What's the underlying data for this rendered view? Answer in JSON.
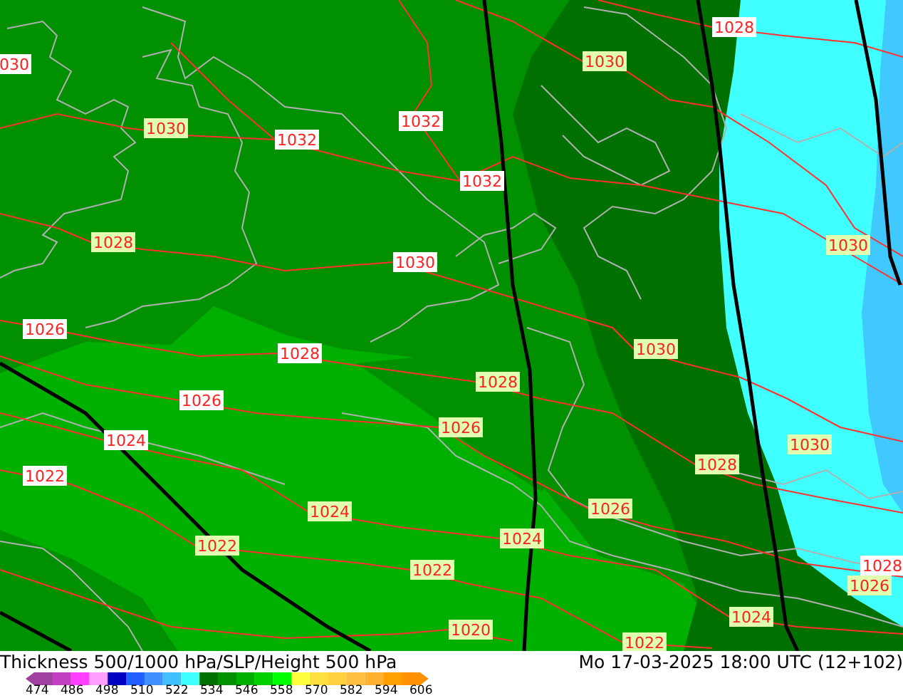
{
  "map": {
    "isobar_labels": [
      {
        "text": "030",
        "color": "#ffffff"
      },
      {
        "text": "1030",
        "color": "#e0ffb0"
      },
      {
        "text": "1032",
        "color": "#ffffff"
      },
      {
        "text": "1032",
        "color": "#ffffff"
      },
      {
        "text": "1028",
        "color": "#ffffff"
      },
      {
        "text": "1030",
        "color": "#e0ffb0"
      },
      {
        "text": "1032",
        "color": "#ffffff"
      },
      {
        "text": "1028",
        "color": "#e0ffb0"
      },
      {
        "text": "1030",
        "color": "#ffffff"
      },
      {
        "text": "1030",
        "color": "#e0ffb0"
      },
      {
        "text": "1026",
        "color": "#ffffff"
      },
      {
        "text": "1028",
        "color": "#ffffff"
      },
      {
        "text": "1030",
        "color": "#e0ffb0"
      },
      {
        "text": "1028",
        "color": "#e0ffb0"
      },
      {
        "text": "1026",
        "color": "#ffffff"
      },
      {
        "text": "1026",
        "color": "#e0ffb0"
      },
      {
        "text": "1024",
        "color": "#ffffff"
      },
      {
        "text": "1030",
        "color": "#e0ffb0"
      },
      {
        "text": "1028",
        "color": "#e0ffb0"
      },
      {
        "text": "1022",
        "color": "#ffffff"
      },
      {
        "text": "1026",
        "color": "#e0ffb0"
      },
      {
        "text": "1024",
        "color": "#e0ffb0"
      },
      {
        "text": "1024",
        "color": "#e0ffb0"
      },
      {
        "text": "1022",
        "color": "#e0ffb0"
      },
      {
        "text": "1028",
        "color": "#ffffff"
      },
      {
        "text": "1022",
        "color": "#e0ffb0"
      },
      {
        "text": "1026",
        "color": "#e0ffb0"
      },
      {
        "text": "1024",
        "color": "#e0ffb0"
      },
      {
        "text": "1020",
        "color": "#e0ffb0"
      },
      {
        "text": "1022",
        "color": "#e0ffb0"
      }
    ]
  },
  "footer": {
    "title": "Thickness 500/1000 hPa/SLP/Height 500 hPa",
    "datetime": "Mo 17-03-2025 18:00 UTC (12+102)",
    "legend": {
      "swatches": [
        {
          "color": "#a040a0"
        },
        {
          "color": "#c040c0"
        },
        {
          "color": "#ff40ff"
        },
        {
          "color": "#ffa0ff"
        },
        {
          "color": "#0000c0"
        },
        {
          "color": "#2060ff"
        },
        {
          "color": "#4090ff"
        },
        {
          "color": "#40c0ff"
        },
        {
          "color": "#40ffff"
        },
        {
          "color": "#007000"
        },
        {
          "color": "#009000"
        },
        {
          "color": "#00b000"
        },
        {
          "color": "#00d000"
        },
        {
          "color": "#00ff00"
        },
        {
          "color": "#ffff40"
        },
        {
          "color": "#ffe040"
        },
        {
          "color": "#ffd040"
        },
        {
          "color": "#ffc040"
        },
        {
          "color": "#ffb030"
        },
        {
          "color": "#ffa000"
        },
        {
          "color": "#ff9000"
        }
      ],
      "ticks": [
        "474",
        "486",
        "498",
        "510",
        "522",
        "534",
        "546",
        "558",
        "570",
        "582",
        "594",
        "606"
      ]
    }
  }
}
